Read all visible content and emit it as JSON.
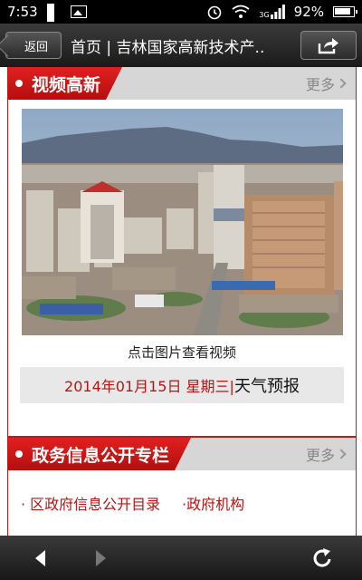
{
  "status": {
    "time": "7:53",
    "network": "3G",
    "battery": "92%"
  },
  "titlebar": {
    "back_label": "返回",
    "title": "首页 | 吉林国家高新技术产.."
  },
  "video_section": {
    "title": "视频高新",
    "more_label": "更多",
    "caption": "点击图片查看视频",
    "date": "2014年01月15日 星期三|",
    "weather": " 天气预报"
  },
  "gov_section": {
    "title": "政务信息公开专栏",
    "more_label": "更多",
    "links": [
      "· 区政府信息公开目录",
      "·政府机构"
    ]
  },
  "icons": {
    "status_left": [
      "grid-icon",
      "image-icon"
    ],
    "status_right": [
      "alarm-icon",
      "wifi-icon",
      "signal-icon",
      "battery-icon"
    ],
    "titlebar": [
      "share-icon"
    ],
    "bottom": [
      "back-arrow-icon",
      "forward-arrow-icon",
      "refresh-icon"
    ]
  },
  "colors": {
    "accent": "#c21a1a",
    "link": "#b41515",
    "bar": "#1a1a1a"
  }
}
